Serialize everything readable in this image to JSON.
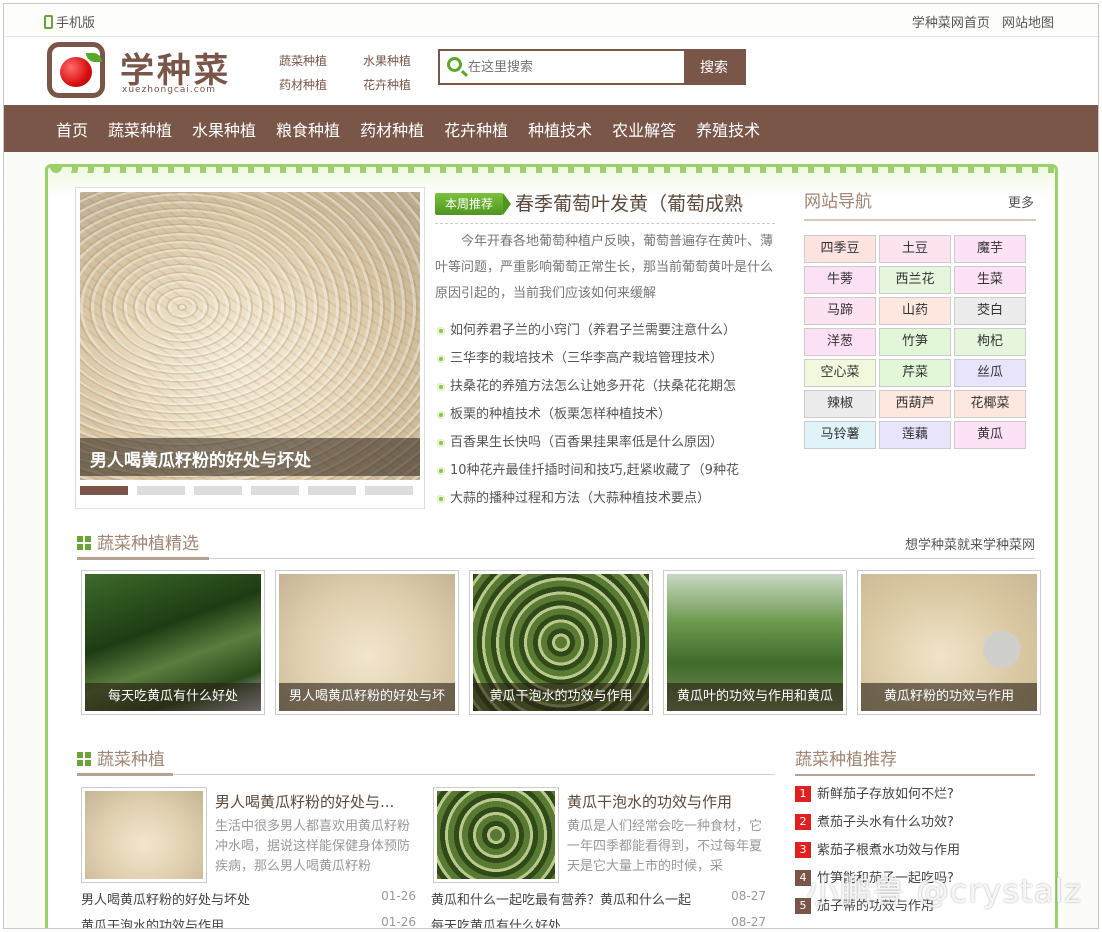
{
  "topbar": {
    "mobile": "手机版",
    "home_link": "学种菜网首页",
    "sitemap_link": "网站地图"
  },
  "logo": {
    "name": "学种菜",
    "domain": "xuezhongcai.com"
  },
  "quick_links": [
    "蔬菜种植",
    "水果种植",
    "药材种植",
    "花卉种植"
  ],
  "search": {
    "placeholder": "在这里搜索",
    "button": "搜索"
  },
  "nav": [
    "首页",
    "蔬菜种植",
    "水果种植",
    "粮食种植",
    "药材种植",
    "花卉种植",
    "种植技术",
    "农业解答",
    "养殖技术"
  ],
  "slider": {
    "caption": "男人喝黄瓜籽粉的好处与坏处",
    "dots": 6,
    "active": 0
  },
  "feature": {
    "tag": "本周推荐",
    "title": "春季葡萄叶发黄（葡萄成熟",
    "text": "今年开春各地葡萄种植户反映，葡萄普遍存在黄叶、薄叶等问题，严重影响葡萄正常生长，那当前葡萄黄叶是什么原因引起的，当前我们应该如何来缓解",
    "list": [
      "如何养君子兰的小窍门（养君子兰需要注意什么）",
      "三华李的栽培技术（三华李高产栽培管理技术）",
      "扶桑花的养殖方法怎么让她多开花（扶桑花花期怎",
      "板栗的种植技术（板栗怎样种植技术）",
      "百香果生长快吗（百香果挂果率低是什么原因）",
      "10种花卉最佳扦插时间和技巧,赶紧收藏了（9种花",
      "大蒜的播种过程和方法（大蒜种植技术要点）"
    ]
  },
  "sitenav": {
    "title": "网站导航",
    "more": "更多",
    "items": [
      {
        "label": "四季豆",
        "color": "#fde3e0"
      },
      {
        "label": "土豆",
        "color": "#fde2f0"
      },
      {
        "label": "魔芋",
        "color": "#fde2f6"
      },
      {
        "label": "牛蒡",
        "color": "#fce0f4"
      },
      {
        "label": "西兰花",
        "color": "#e6f6dc"
      },
      {
        "label": "生菜",
        "color": "#fde2f6"
      },
      {
        "label": "马蹄",
        "color": "#fde2f0"
      },
      {
        "label": "山药",
        "color": "#fde7df"
      },
      {
        "label": "茭白",
        "color": "#ececec"
      },
      {
        "label": "洋葱",
        "color": "#fce0f4"
      },
      {
        "label": "竹笋",
        "color": "#e2f7d8"
      },
      {
        "label": "枸杞",
        "color": "#e6f6dc"
      },
      {
        "label": "空心菜",
        "color": "#f2f8dc"
      },
      {
        "label": "芹菜",
        "color": "#e2f7d8"
      },
      {
        "label": "丝瓜",
        "color": "#e8e4fb"
      },
      {
        "label": "辣椒",
        "color": "#ececec"
      },
      {
        "label": "西葫芦",
        "color": "#fde7df"
      },
      {
        "label": "花椰菜",
        "color": "#fde7df"
      },
      {
        "label": "马铃薯",
        "color": "#dff3f8"
      },
      {
        "label": "莲藕",
        "color": "#e8e4fb"
      },
      {
        "label": "黄瓜",
        "color": "#fde2f6"
      }
    ]
  },
  "section1": {
    "title": "蔬菜种植精选",
    "right": "想学种菜就来学种菜网",
    "photos": [
      {
        "caption": "每天吃黄瓜有什么好处",
        "image": "cucumber"
      },
      {
        "caption": "男人喝黄瓜籽粉的好处与坏",
        "image": "seeds"
      },
      {
        "caption": "黄瓜干泡水的功效与作用",
        "image": "dried-cucumber"
      },
      {
        "caption": "黄瓜叶的功效与作用和黄瓜",
        "image": "greenhouse"
      },
      {
        "caption": "黄瓜籽粉的功效与作用",
        "image": "seeds-coin"
      }
    ]
  },
  "section2": {
    "title": "蔬菜种植",
    "items": [
      {
        "title": "男人喝黄瓜籽粉的好处与...",
        "desc": "生活中很多男人都喜欢用黄瓜籽粉冲水喝，据说这样能保健身体预防疾病，那么男人喝黄瓜籽粉"
      },
      {
        "title": "黄瓜干泡水的功效与作用",
        "desc": "黄瓜是人们经常会吃一种食材，它一年四季都能看得到，不过每年夏天是它大量上市的时候，采"
      }
    ],
    "rows": [
      {
        "text": "男人喝黄瓜籽粉的好处与坏处",
        "date": "01-26"
      },
      {
        "text": "黄瓜和什么一起吃最有营养？黄瓜和什么一起",
        "date": "08-27"
      },
      {
        "text": "黄瓜干泡水的功效与作用",
        "date": "01-26"
      },
      {
        "text": "每天吃黄瓜有什么好处",
        "date": "08-27"
      }
    ]
  },
  "recommend": {
    "title": "蔬菜种植推荐",
    "items": [
      {
        "num": "1",
        "text": "新鲜茄子存放如何不烂?",
        "color": "#e02020"
      },
      {
        "num": "2",
        "text": "煮茄子头水有什么功效?",
        "color": "#e02020"
      },
      {
        "num": "3",
        "text": "紫茄子根煮水功效与作用",
        "color": "#e02020"
      },
      {
        "num": "4",
        "text": "竹笋能和茄子一起吃吗?",
        "color": "#7a5648"
      },
      {
        "num": "5",
        "text": "茄子蒂的功效与作用",
        "color": "#7a5648"
      }
    ]
  },
  "watermark": "小鹏鲁 @crystalz"
}
